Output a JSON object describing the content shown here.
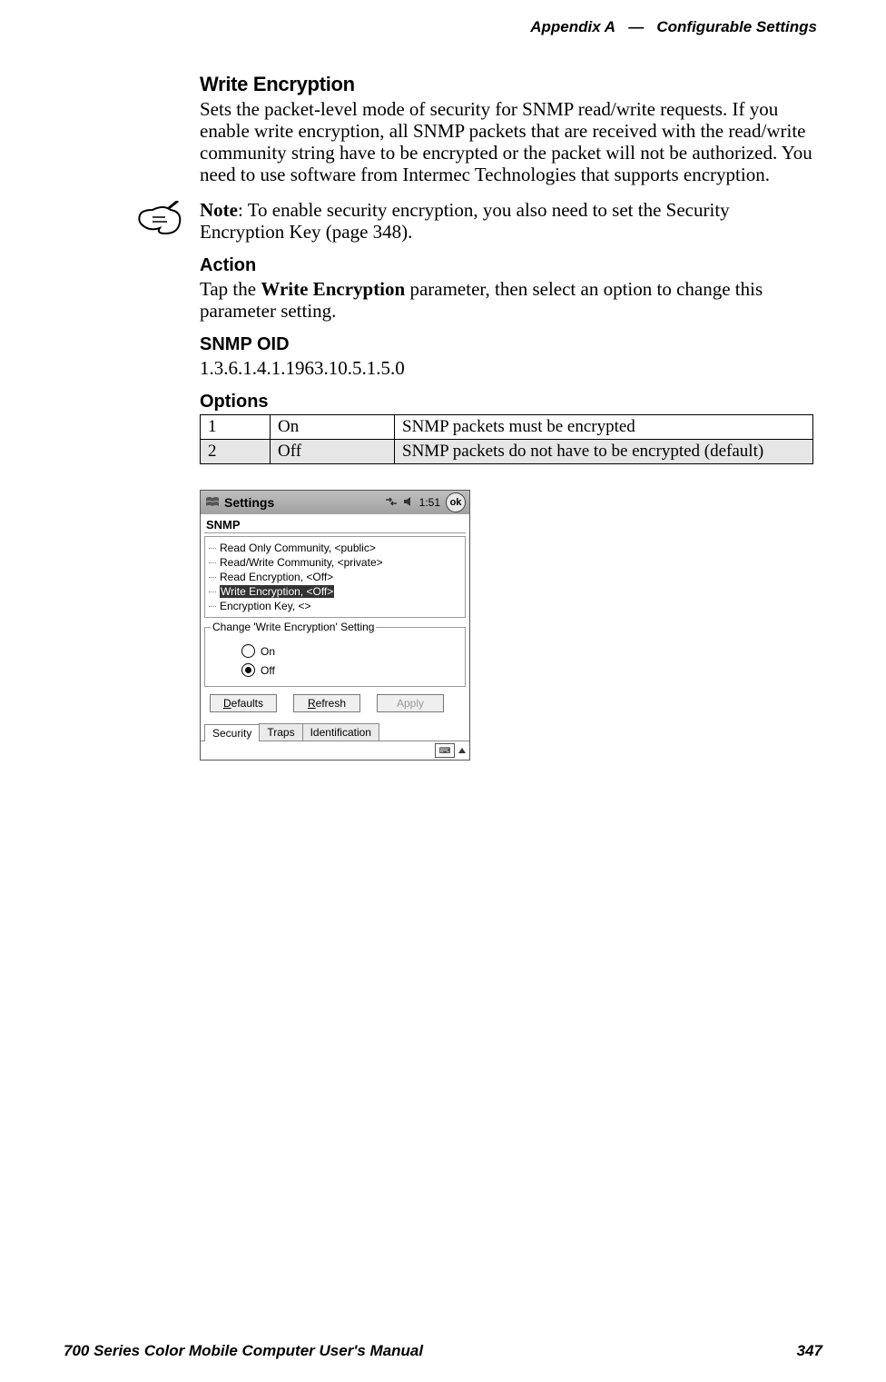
{
  "header": {
    "appendix": "Appendix A",
    "sep": "—",
    "section": "Configurable Settings"
  },
  "section": {
    "title": "Write Encryption",
    "body": "Sets the packet-level mode of security for SNMP read/write requests. If you enable write encryption, all SNMP packets that are received with the read/write community string have to be encrypted or the packet will not be authorized. You need to use software from Intermec Technologies that supports encryption."
  },
  "note": {
    "label": "Note",
    "text": ": To enable security encryption, you also need to set the Security Encryption Key (page 348)."
  },
  "action": {
    "title": "Action",
    "pre": "Tap the ",
    "bold": "Write Encryption",
    "post": " parameter, then select an option to change this parameter setting."
  },
  "snmp": {
    "title": "SNMP OID",
    "value": "1.3.6.1.4.1.1963.10.5.1.5.0"
  },
  "options": {
    "title": "Options",
    "rows": [
      {
        "num": "1",
        "label": "On",
        "desc": "SNMP packets must be encrypted"
      },
      {
        "num": "2",
        "label": "Off",
        "desc": "SNMP packets do not have to be encrypted (default)"
      }
    ]
  },
  "device": {
    "titlebar": {
      "app": "Settings",
      "time": "1:51",
      "ok": "ok"
    },
    "panel": "SNMP",
    "tree": [
      "Read Only Community, <public>",
      "Read/Write Community, <private>",
      "Read Encryption, <Off>",
      "Write Encryption, <Off>",
      "Encryption Key, <>"
    ],
    "legend": "Change 'Write Encryption' Setting",
    "radios": {
      "on": "On",
      "off": "Off"
    },
    "buttons": {
      "defaults": "Defaults",
      "refresh": "Refresh",
      "apply": "Apply",
      "d": "D",
      "r": "R",
      "a": "A"
    },
    "tabs": {
      "security": "Security",
      "traps": "Traps",
      "identification": "Identification"
    }
  },
  "footer": {
    "left": "700 Series Color Mobile Computer User's Manual",
    "right": "347"
  }
}
